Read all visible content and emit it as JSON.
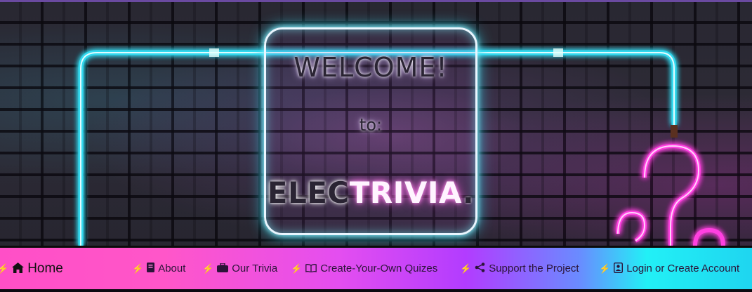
{
  "hero": {
    "welcome_title": "WELCOME!",
    "welcome_to": "to:",
    "brand_part1": "ELEC",
    "brand_part2": "TRIVIA",
    "brand_part3": "."
  },
  "nav": {
    "bolt": "⚡",
    "items": [
      {
        "label": "Home",
        "icon": "home-icon"
      },
      {
        "label": "About",
        "icon": "book-icon"
      },
      {
        "label": "Our Trivia",
        "icon": "briefcase-icon"
      },
      {
        "label": "Create-Your-Own Quizes",
        "icon": "open-book-icon"
      },
      {
        "label": "Support the Project",
        "icon": "share-icon"
      },
      {
        "label": "Login or Create Account",
        "icon": "contact-card-icon"
      }
    ]
  },
  "colors": {
    "neon_cyan": "#31d9ef",
    "neon_pink": "#ff3fe0",
    "nav_pink": "#ff4fc7",
    "nav_purple": "#b23cff",
    "nav_cyan": "#22f0f6"
  }
}
